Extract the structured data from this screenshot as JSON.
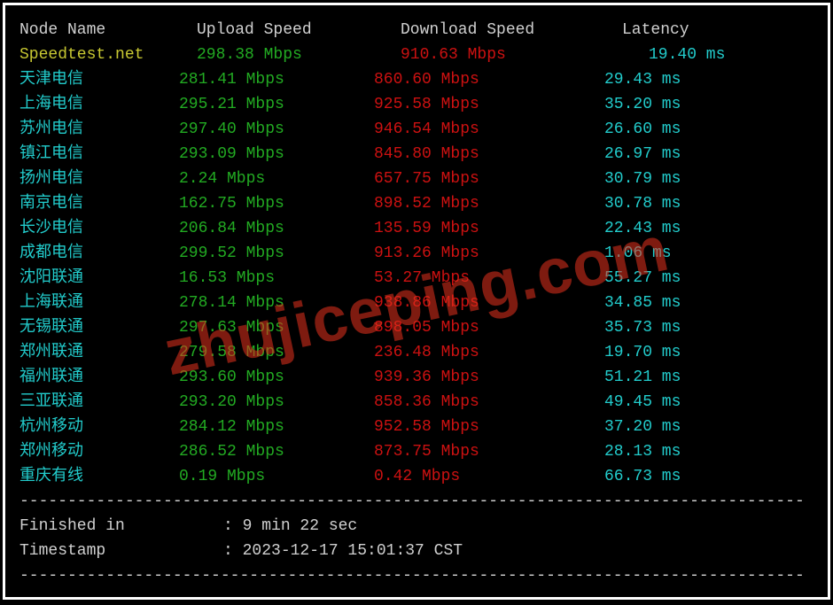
{
  "headers": {
    "node": "Node Name",
    "upload": "Upload Speed",
    "download": "Download Speed",
    "latency": "Latency"
  },
  "rows": [
    {
      "node": "Speedtest.net",
      "node_color": "yellow",
      "upload": "298.38 Mbps",
      "download": "910.63 Mbps",
      "latency": "19.40 ms",
      "latency_indent": true
    },
    {
      "node": "天津电信",
      "node_color": "cyan",
      "upload": "281.41 Mbps",
      "download": "860.60 Mbps",
      "latency": "29.43 ms"
    },
    {
      "node": "上海电信",
      "node_color": "cyan",
      "upload": "295.21 Mbps",
      "download": "925.58 Mbps",
      "latency": "35.20 ms"
    },
    {
      "node": "苏州电信",
      "node_color": "cyan",
      "upload": "297.40 Mbps",
      "download": "946.54 Mbps",
      "latency": "26.60 ms"
    },
    {
      "node": "镇江电信",
      "node_color": "cyan",
      "upload": "293.09 Mbps",
      "download": "845.80 Mbps",
      "latency": "26.97 ms"
    },
    {
      "node": "扬州电信",
      "node_color": "cyan",
      "upload": "2.24 Mbps",
      "download": "657.75 Mbps",
      "latency": "30.79 ms"
    },
    {
      "node": "南京电信",
      "node_color": "cyan",
      "upload": "162.75 Mbps",
      "download": "898.52 Mbps",
      "latency": "30.78 ms"
    },
    {
      "node": "长沙电信",
      "node_color": "cyan",
      "upload": "206.84 Mbps",
      "download": "135.59 Mbps",
      "latency": "22.43 ms"
    },
    {
      "node": "成都电信",
      "node_color": "cyan",
      "upload": "299.52 Mbps",
      "download": "913.26 Mbps",
      "latency": "1.06 ms"
    },
    {
      "node": "沈阳联通",
      "node_color": "cyan",
      "upload": "16.53 Mbps",
      "download": "53.27 Mbps",
      "latency": "55.27 ms"
    },
    {
      "node": "上海联通",
      "node_color": "cyan",
      "upload": "278.14 Mbps",
      "download": "938.86 Mbps",
      "latency": "34.85 ms"
    },
    {
      "node": "无锡联通",
      "node_color": "cyan",
      "upload": "297.63 Mbps",
      "download": "898.05 Mbps",
      "latency": "35.73 ms"
    },
    {
      "node": "郑州联通",
      "node_color": "cyan",
      "upload": "279.58 Mbps",
      "download": "236.48 Mbps",
      "latency": "19.70 ms"
    },
    {
      "node": "福州联通",
      "node_color": "cyan",
      "upload": "293.60 Mbps",
      "download": "939.36 Mbps",
      "latency": "51.21 ms"
    },
    {
      "node": "三亚联通",
      "node_color": "cyan",
      "upload": "293.20 Mbps",
      "download": "858.36 Mbps",
      "latency": "49.45 ms"
    },
    {
      "node": "杭州移动",
      "node_color": "cyan",
      "upload": "284.12 Mbps",
      "download": "952.58 Mbps",
      "latency": "37.20 ms"
    },
    {
      "node": "郑州移动",
      "node_color": "cyan",
      "upload": "286.52 Mbps",
      "download": "873.75 Mbps",
      "latency": "28.13 ms"
    },
    {
      "node": "重庆有线",
      "node_color": "cyan",
      "upload": "0.19 Mbps",
      "download": "0.42 Mbps",
      "latency": "66.73 ms"
    }
  ],
  "footer": {
    "finished_label": "Finished in",
    "finished_value": "9 min 22 sec",
    "timestamp_label": "Timestamp",
    "timestamp_value": "2023-12-17 15:01:37 CST"
  },
  "divider": "----------------------------------------------------------------------------------",
  "watermark": "zhujiceping.com"
}
